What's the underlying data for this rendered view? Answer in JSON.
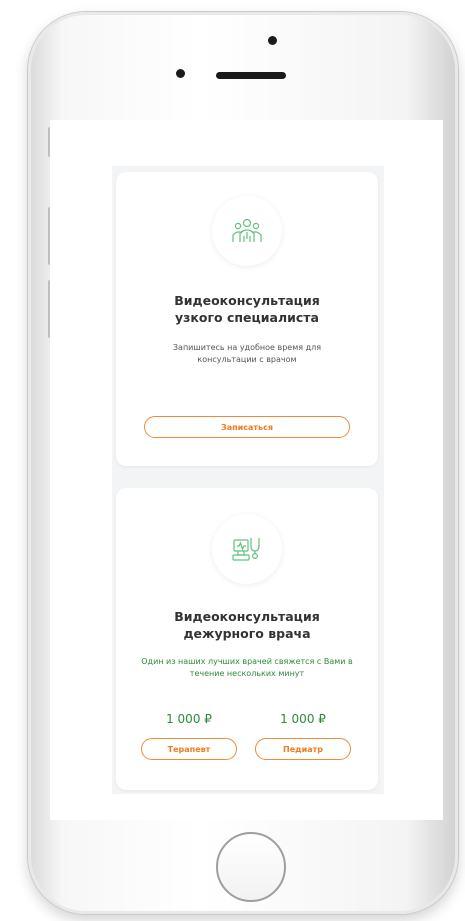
{
  "cards": [
    {
      "title_line1": "Видеоконсультация",
      "title_line2": "узкого специалиста",
      "desc_line1": "Запишитесь на удобное время для",
      "desc_line2": "консультации с врачом",
      "button": "Записаться",
      "icon": "doctors-group-icon"
    },
    {
      "title_line1": "Видеоконсультация",
      "title_line2": "дежурного врача",
      "desc_line1": "Один из наших лучших врачей свяжется с Вами в",
      "desc_line2": "течение нескольких минут",
      "icon": "medical-monitor-stethoscope-icon",
      "options": [
        {
          "price": "1 000 ₽",
          "button": "Терапевт"
        },
        {
          "price": "1 000 ₽",
          "button": "Педиатр"
        }
      ]
    }
  ],
  "colors": {
    "accent_orange": "#f07a1e",
    "price_green": "#2e8b3a",
    "icon_green": "#5fc37a",
    "title_dark": "#333333",
    "desc_gray": "#555555",
    "desc_green": "#2e8b3a"
  }
}
